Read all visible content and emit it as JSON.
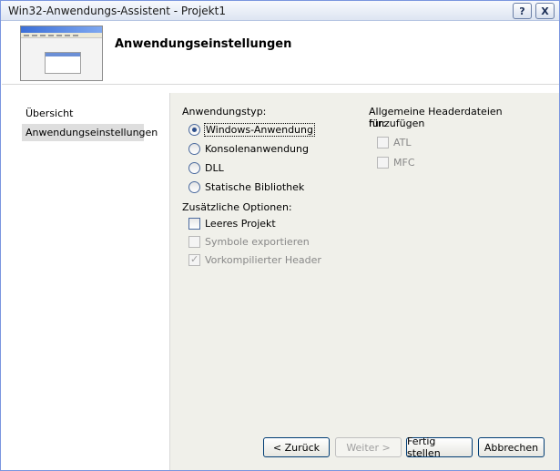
{
  "window": {
    "title": "Win32-Anwendungs-Assistent - Projekt1",
    "help_label": "?",
    "close_label": "X"
  },
  "header": {
    "title": "Anwendungseinstellungen"
  },
  "nav": {
    "items": [
      {
        "label": "Übersicht"
      },
      {
        "label": "Anwendungseinstellungen"
      }
    ]
  },
  "app_type": {
    "label": "Anwendungstyp:",
    "options": [
      {
        "label": "Windows-Anwendung",
        "selected": true
      },
      {
        "label": "Konsolenanwendung",
        "selected": false
      },
      {
        "label": "DLL",
        "selected": false
      },
      {
        "label": "Statische Bibliothek",
        "selected": false
      }
    ]
  },
  "additional": {
    "label": "Zusätzliche Optionen:",
    "options": [
      {
        "label": "Leeres Projekt",
        "checked": false,
        "enabled": true
      },
      {
        "label": "Symbole exportieren",
        "checked": false,
        "enabled": false
      },
      {
        "label": "Vorkompilierter Header",
        "checked": true,
        "enabled": false
      }
    ]
  },
  "headers": {
    "label_line1": "Allgemeine Headerdateien hinzufügen",
    "label_line2": "für:",
    "options": [
      {
        "label": "ATL",
        "checked": false,
        "enabled": false
      },
      {
        "label": "MFC",
        "checked": false,
        "enabled": false
      }
    ]
  },
  "buttons": {
    "back": "< Zurück",
    "next": "Weiter >",
    "finish": "Fertig stellen",
    "cancel": "Abbrechen"
  }
}
